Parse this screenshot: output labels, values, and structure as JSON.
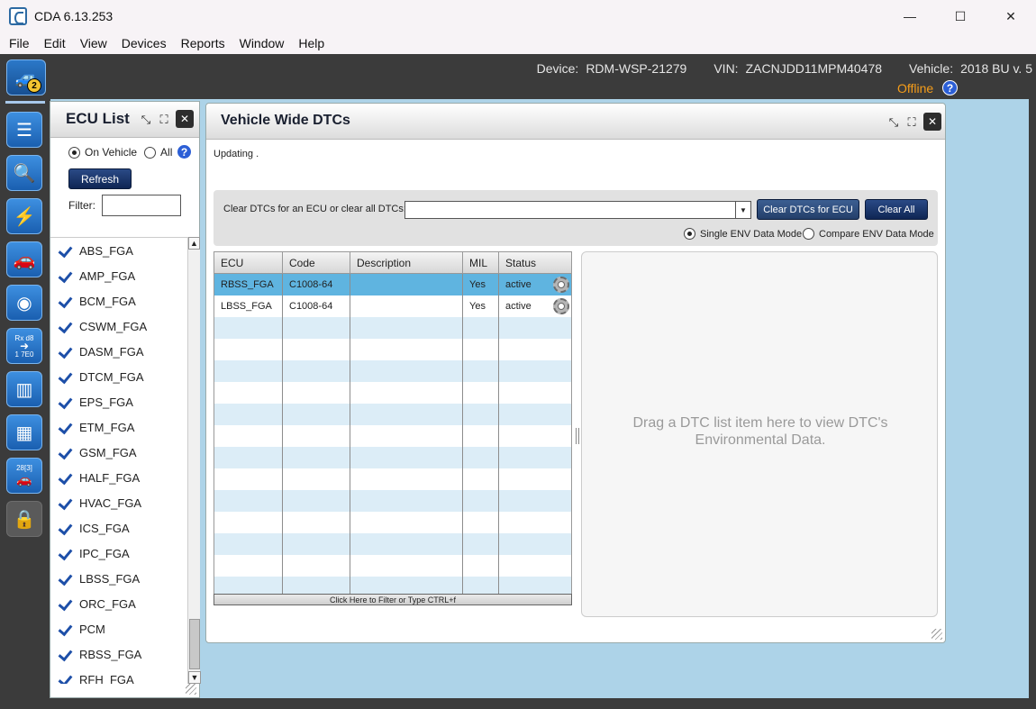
{
  "window": {
    "title": "CDA 6.13.253",
    "controls": {
      "minimize": "—",
      "maximize": "☐",
      "close": "✕"
    }
  },
  "menu": [
    "File",
    "Edit",
    "View",
    "Devices",
    "Reports",
    "Window",
    "Help"
  ],
  "info": {
    "device_label": "Device:",
    "device": "RDM-WSP-21279",
    "vin_label": "VIN:",
    "vin": "ZACNJDD11MPM40478",
    "vehicle_label": "Vehicle:",
    "vehicle": "2018 BU v. 5",
    "status": "Offline",
    "status_color": "#f59d1a",
    "help": "?"
  },
  "toolbar": {
    "badge": "2",
    "rx_label": "Rx d8",
    "rx_sub": "1 7E0",
    "calendar_label": "28[3]"
  },
  "ecu_list": {
    "title": "ECU List",
    "radio_on_vehicle": "On Vehicle",
    "radio_all": "All",
    "help": "?",
    "refresh": "Refresh",
    "filter_label": "Filter:",
    "filter_value": "",
    "items": [
      "ABS_FGA",
      "AMP_FGA",
      "BCM_FGA",
      "CSWM_FGA",
      "DASM_FGA",
      "DTCM_FGA",
      "EPS_FGA",
      "ETM_FGA",
      "GSM_FGA",
      "HALF_FGA",
      "HVAC_FGA",
      "ICS_FGA",
      "IPC_FGA",
      "LBSS_FGA",
      "ORC_FGA",
      "PCM",
      "RBSS_FGA",
      "RFH_FGA"
    ]
  },
  "dtc": {
    "title": "Vehicle Wide DTCs",
    "updating": "Updating  .",
    "clear_label": "Clear DTCs for an ECU or clear all DTCs:",
    "ecu_select_value": "",
    "clear_ecu_btn": "Clear DTCs for ECU",
    "clear_all_btn": "Clear All",
    "mode_single": "Single ENV Data Mode",
    "mode_compare": "Compare ENV Data Mode",
    "columns": {
      "ecu": "ECU",
      "code": "Code",
      "description": "Description",
      "mil": "MIL",
      "status": "Status"
    },
    "rows": [
      {
        "ecu": "RBSS_FGA",
        "code": "C1008-64",
        "description": "",
        "mil": "Yes",
        "status": "active"
      },
      {
        "ecu": "LBSS_FGA",
        "code": "C1008-64",
        "description": "",
        "mil": "Yes",
        "status": "active"
      }
    ],
    "filter_bar": "Click Here to Filter or Type CTRL+f",
    "env_placeholder": "Drag a DTC list item here to view DTC's Environmental Data."
  },
  "colors": {
    "accent": "#0f2654",
    "selected_row": "#5fb4e0",
    "alt_row": "#dcedf7",
    "workspace": "#add3e8"
  }
}
